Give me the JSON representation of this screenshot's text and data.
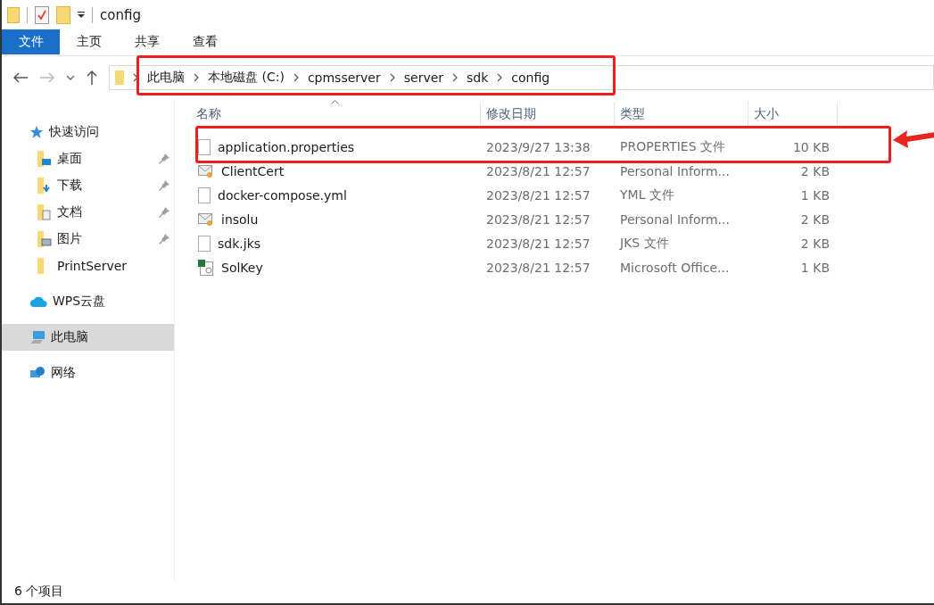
{
  "window": {
    "title": "config"
  },
  "ribbon_tabs": [
    {
      "label": "文件",
      "selected": true
    },
    {
      "label": "主页",
      "selected": false
    },
    {
      "label": "共享",
      "selected": false
    },
    {
      "label": "查看",
      "selected": false
    }
  ],
  "address_bar": {
    "highlighted": true,
    "path": [
      "此电脑",
      "本地磁盘 (C:)",
      "cpmsserver",
      "server",
      "sdk",
      "config"
    ]
  },
  "sidebar": {
    "items": [
      {
        "label": "快速访问",
        "kind": "star",
        "selected": false,
        "children": [
          {
            "label": "桌面",
            "kind": "desktop",
            "pinned": true,
            "selected": false
          },
          {
            "label": "下载",
            "kind": "download",
            "pinned": true,
            "selected": false
          },
          {
            "label": "文档",
            "kind": "documents",
            "pinned": true,
            "selected": false
          },
          {
            "label": "图片",
            "kind": "pictures",
            "pinned": true,
            "selected": false
          },
          {
            "label": "PrintServer",
            "kind": "folder",
            "pinned": false,
            "selected": false
          }
        ]
      },
      {
        "label": "WPS云盘",
        "kind": "cloud",
        "selected": false
      },
      {
        "label": "此电脑",
        "kind": "computer",
        "selected": true
      },
      {
        "label": "网络",
        "kind": "network",
        "selected": false
      }
    ]
  },
  "table": {
    "columns": [
      "名称",
      "修改日期",
      "类型",
      "大小"
    ],
    "rows": [
      {
        "name": "application.properties",
        "kind": "file",
        "date": "2023/9/27 13:38",
        "type": "PROPERTIES 文件",
        "size": "10 KB",
        "highlighted": true
      },
      {
        "name": "ClientCert",
        "kind": "certificate",
        "date": "2023/8/21 12:57",
        "type": "Personal Inform...",
        "size": "2 KB",
        "highlighted": false
      },
      {
        "name": "docker-compose.yml",
        "kind": "file",
        "date": "2023/8/21 12:57",
        "type": "YML 文件",
        "size": "1 KB",
        "highlighted": false
      },
      {
        "name": "insolu",
        "kind": "certificate",
        "date": "2023/8/21 12:57",
        "type": "Personal Inform...",
        "size": "2 KB",
        "highlighted": false
      },
      {
        "name": "sdk.jks",
        "kind": "file",
        "date": "2023/8/21 12:57",
        "type": "JKS 文件",
        "size": "2 KB",
        "highlighted": false
      },
      {
        "name": "SolKey",
        "kind": "spreadsheet",
        "date": "2023/8/21 12:57",
        "type": "Microsoft Office...",
        "size": "1 KB",
        "highlighted": false
      }
    ]
  },
  "status_bar": {
    "item_count": "6 个项目"
  }
}
